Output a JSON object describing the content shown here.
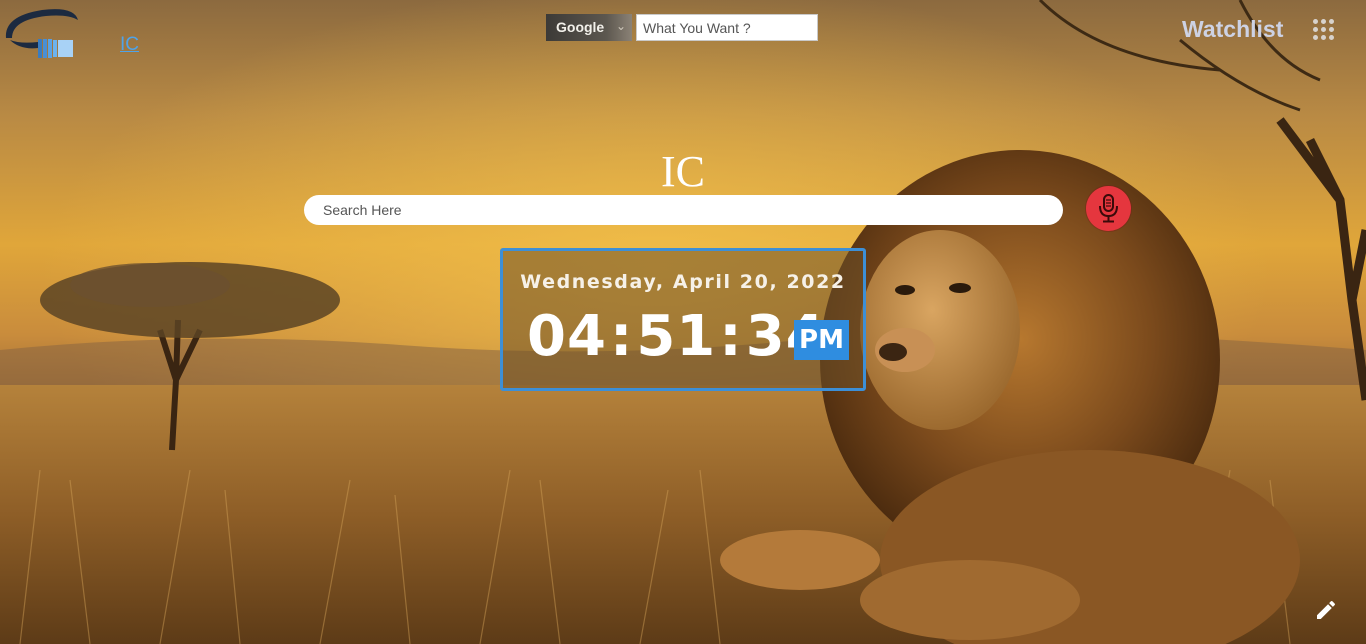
{
  "header": {
    "brand_text": "IC",
    "engine": {
      "selected": "Google"
    },
    "query": {
      "placeholder": "What You Want ?",
      "value": ""
    },
    "watchlist_label": "Watchlist"
  },
  "main": {
    "title": "IC",
    "search": {
      "placeholder": "Search Here",
      "value": ""
    }
  },
  "clock": {
    "date": "Wednesday, April 20, 2022",
    "hours": "04",
    "minutes": "51",
    "seconds": "34",
    "separator": ":",
    "meridiem": "PM"
  },
  "icons": {
    "logo": "ic-logo",
    "select_arrow": "chevron-down-icon",
    "apps": "apps-grid-icon",
    "mic": "microphone-icon",
    "edit": "pencil-icon"
  },
  "colors": {
    "accent_blue": "#2f8de0",
    "clock_border": "#3d8fd6",
    "mic_red": "#e5363e",
    "watchlist_text": "#cdd2e4",
    "brand_link": "#4fa3e8"
  }
}
